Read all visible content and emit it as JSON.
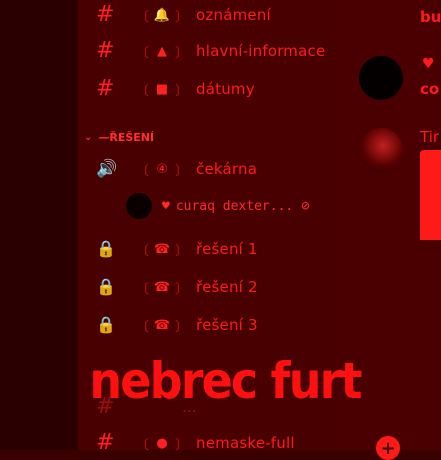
{
  "channels": [
    {
      "prefix": "#",
      "emoji": "🔔",
      "label": "oznámení"
    },
    {
      "prefix": "#",
      "emoji": "▲",
      "label": "hlavní-informace"
    },
    {
      "prefix": "#",
      "emoji": "■",
      "label": "dátumy"
    }
  ],
  "category": {
    "label": "ŘEŠENÍ",
    "dash": "—"
  },
  "voice_channel": {
    "prefix": "🔊",
    "emoji": "④",
    "label": "čekárna"
  },
  "voice_user": {
    "name": "curaq dexter...",
    "heart": "♥",
    "muted": "⊘"
  },
  "locked_channels": [
    {
      "emoji": "☎",
      "label": "řešení 1"
    },
    {
      "emoji": "☎",
      "label": "řešení 2"
    },
    {
      "emoji": "☎",
      "label": "řešení 3"
    }
  ],
  "hidden_channels": [
    {
      "prefix": "#",
      "label": "..."
    },
    {
      "prefix": "#",
      "label": "nemaske-full"
    }
  ],
  "chat": {
    "top_text": "bu",
    "line2_icon": "♥",
    "line2_text": "co",
    "line3_text": "Tir"
  },
  "overlay_text": "nebrec furt",
  "icons": {
    "lock": "🔒",
    "bracket_open": "〔",
    "bracket_close": "〕",
    "add": "+"
  }
}
